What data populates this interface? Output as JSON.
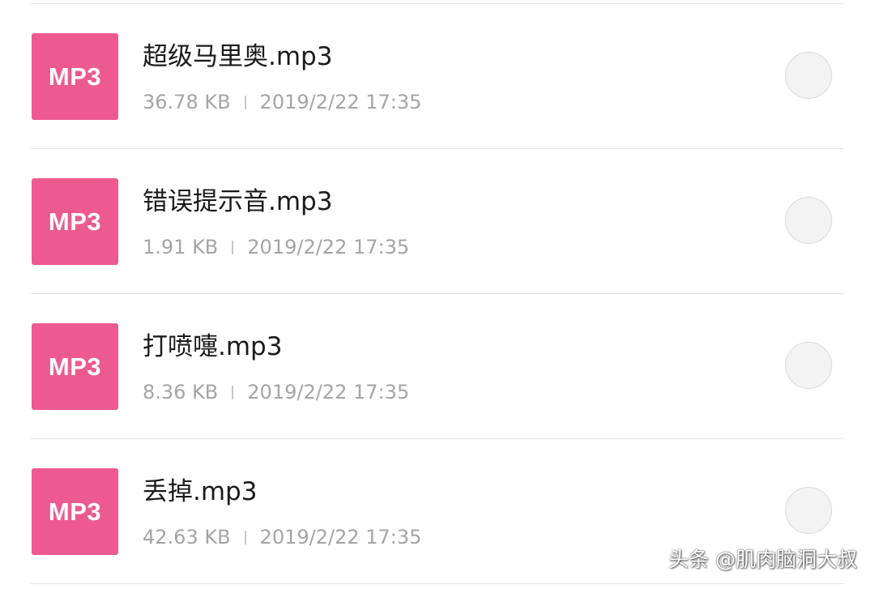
{
  "colors": {
    "mp3_icon": "#ec5a90"
  },
  "files": [
    {
      "icon_label": "MP3",
      "name": "超级马里奥.mp3",
      "size": "36.78 KB",
      "date": "2019/2/22 17:35"
    },
    {
      "icon_label": "MP3",
      "name": "错误提示音.mp3",
      "size": "1.91 KB",
      "date": "2019/2/22 17:35"
    },
    {
      "icon_label": "MP3",
      "name": "打喷嚏.mp3",
      "size": "8.36 KB",
      "date": "2019/2/22 17:35"
    },
    {
      "icon_label": "MP3",
      "name": "丢掉.mp3",
      "size": "42.63 KB",
      "date": "2019/2/22 17:35"
    }
  ],
  "watermark": "头条 @肌肉脑洞大叔"
}
